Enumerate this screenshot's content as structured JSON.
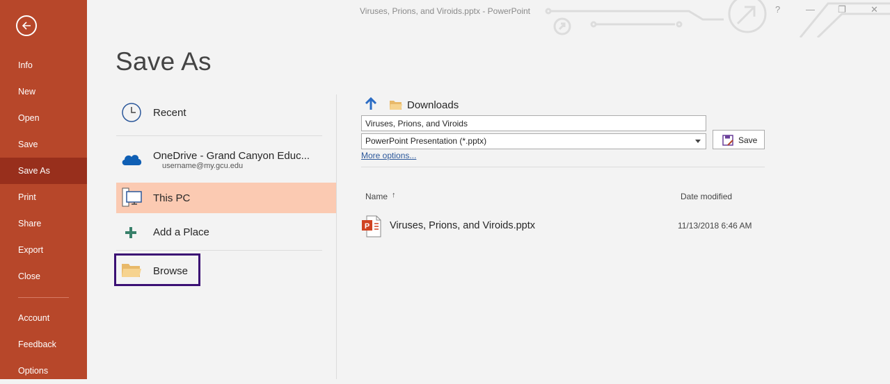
{
  "window": {
    "title": "Viruses, Prions, and Viroids.pptx  -  PowerPoint",
    "help_symbol": "?",
    "minimize_symbol": "—",
    "restore_symbol": "❐",
    "close_symbol": "✕"
  },
  "sidebar": {
    "items": [
      {
        "label": "Info"
      },
      {
        "label": "New"
      },
      {
        "label": "Open"
      },
      {
        "label": "Save"
      },
      {
        "label": "Save As"
      },
      {
        "label": "Print"
      },
      {
        "label": "Share"
      },
      {
        "label": "Export"
      },
      {
        "label": "Close"
      },
      {
        "label": "Account"
      },
      {
        "label": "Feedback"
      },
      {
        "label": "Options"
      }
    ],
    "active": "Save As",
    "bg_color": "#b7472a"
  },
  "page": {
    "title": "Save As"
  },
  "locations": {
    "recent": "Recent",
    "onedrive": {
      "label": "OneDrive - Grand Canyon Educ...",
      "account": "username@my.gcu.edu"
    },
    "this_pc": "This PC",
    "add_place": "Add a Place",
    "browse": "Browse"
  },
  "save_pane": {
    "current_folder": "Downloads",
    "filename": "Viruses, Prions, and Viroids",
    "file_type": "PowerPoint Presentation (*.pptx)",
    "more_options": "More options...",
    "save_label": "Save"
  },
  "file_list": {
    "columns": {
      "name": "Name",
      "date": "Date modified"
    },
    "sort_symbol": "↑",
    "files": [
      {
        "name": "Viruses, Prions, and Viroids.pptx",
        "date": "11/13/2018 6:46 AM",
        "icon_letter": "P"
      }
    ]
  }
}
